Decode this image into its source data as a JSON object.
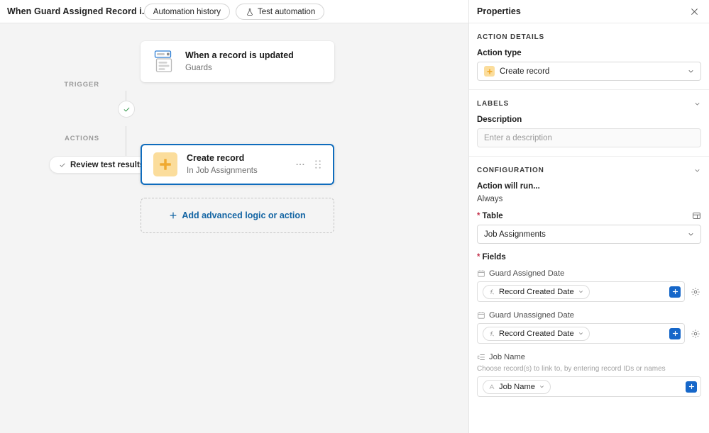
{
  "topbar": {
    "title": "When Guard Assigned Record i...",
    "info_icon": "info-circle-icon",
    "chevron_icon": "chevron-down-icon",
    "automation_history_label": "Automation history",
    "test_automation_label": "Test automation",
    "test_automation_icon": "flask-icon"
  },
  "canvas": {
    "trigger_label": "TRIGGER",
    "actions_label": "ACTIONS",
    "review_pill_label": "Review test results",
    "review_pill_icon": "check-icon",
    "status_icon": "check-circle-icon",
    "trigger_card": {
      "title": "When a record is updated",
      "subtitle": "Guards",
      "icon": "record-updated-icon"
    },
    "action_card": {
      "title": "Create record",
      "subtitle": "In Job Assignments",
      "icon": "plus-tile-icon",
      "more_icon": "more-horizontal-icon",
      "drag_icon": "drag-handle-icon"
    },
    "add_step_label": "Add advanced logic or action",
    "add_step_icon": "plus-icon"
  },
  "panel": {
    "title": "Properties",
    "close_icon": "close-icon",
    "action_details": {
      "section_title": "ACTION DETAILS",
      "action_type_label": "Action type",
      "action_type_value": "Create record",
      "action_type_icon": "plus-tile-icon",
      "chevron_icon": "chevron-down-icon"
    },
    "labels": {
      "section_title": "LABELS",
      "collapse_icon": "chevron-down-icon",
      "description_label": "Description",
      "description_value": "",
      "description_placeholder": "Enter a description"
    },
    "configuration": {
      "section_title": "CONFIGURATION",
      "collapse_icon": "chevron-down-icon",
      "run_label": "Action will run...",
      "run_value": "Always",
      "table_label": "Table",
      "table_expand_icon": "open-table-icon",
      "table_value": "Job Assignments",
      "table_chevron_icon": "chevron-down-icon",
      "fields_label": "Fields",
      "fields": [
        {
          "name": "Guard Assigned Date",
          "icon": "calendar-icon",
          "hint": "",
          "token": "Record Created Date",
          "token_icon": "function-icon",
          "token_chevron": "chevron-down-icon",
          "add_icon": "blue-plus-icon",
          "settings_icon": "gear-icon",
          "has_settings": true
        },
        {
          "name": "Guard Unassigned Date",
          "icon": "calendar-icon",
          "hint": "",
          "token": "Record Created Date",
          "token_icon": "function-icon",
          "token_chevron": "chevron-down-icon",
          "add_icon": "blue-plus-icon",
          "settings_icon": "gear-icon",
          "has_settings": true
        },
        {
          "name": "Job Name",
          "icon": "link-list-icon",
          "hint": "Choose record(s) to link to, by entering record IDs or names",
          "token": "Job Name",
          "token_icon": "text-field-icon",
          "token_chevron": "chevron-down-icon",
          "add_icon": "blue-plus-icon",
          "settings_icon": "",
          "has_settings": false
        }
      ]
    }
  },
  "colors": {
    "accent_blue": "#1667c9",
    "selected_border": "#0f6cbd",
    "link_blue": "#1264a3",
    "amber_tile": "#fbdd9c",
    "amber_glyph": "#f0a92e",
    "required_red": "#c4314b",
    "success_green": "#3a9a50",
    "canvas_bg": "#f4f4f4"
  }
}
